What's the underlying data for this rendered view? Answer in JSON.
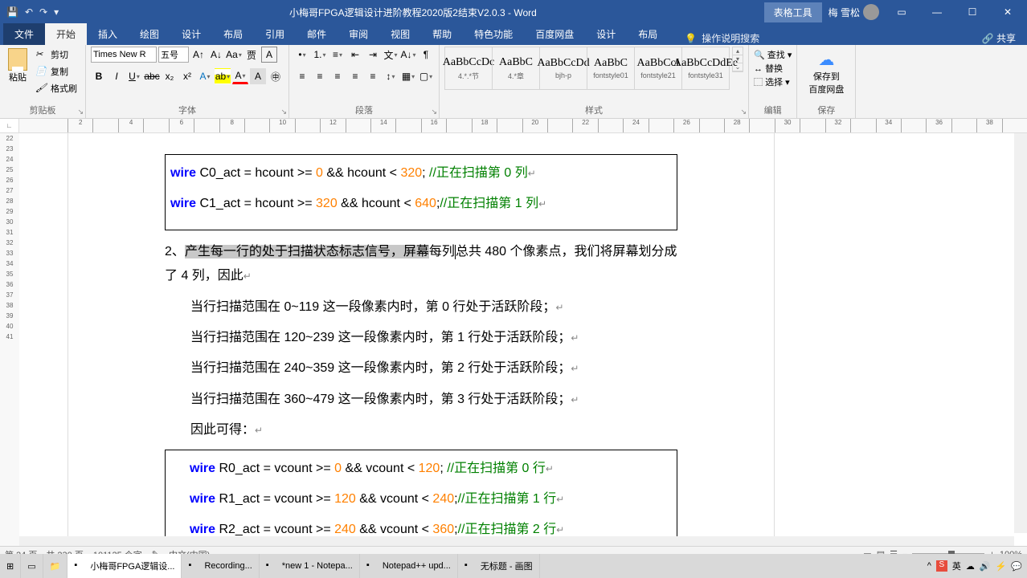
{
  "titlebar": {
    "doc_title": "小梅哥FPGA逻辑设计进阶教程2020版2结束V2.0.3  -  Word",
    "table_tools": "表格工具",
    "user_name": "梅 雪松"
  },
  "tabs": {
    "file": "文件",
    "home": "开始",
    "insert": "插入",
    "draw": "绘图",
    "design": "设计",
    "layout": "布局",
    "references": "引用",
    "mailings": "邮件",
    "review": "审阅",
    "view": "视图",
    "help": "帮助",
    "special": "特色功能",
    "baidu": "百度网盘",
    "t_design": "设计",
    "t_layout": "布局",
    "tellme": "操作说明搜索",
    "share": "共享"
  },
  "ribbon": {
    "clipboard": {
      "label": "剪贴板",
      "cut": "剪切",
      "copy": "复制",
      "fmt": "格式刷",
      "paste": "粘贴"
    },
    "font": {
      "label": "字体",
      "family": "Times New R",
      "size": "五号"
    },
    "para": {
      "label": "段落"
    },
    "styles": {
      "label": "样式",
      "items": [
        {
          "preview": "AaBbCcDc",
          "name": "4.*.*节"
        },
        {
          "preview": "AaBbC",
          "name": "4.*章"
        },
        {
          "preview": "AaBbCcDd",
          "name": "bjh-p"
        },
        {
          "preview": "AaBbC",
          "name": "fontstyle01"
        },
        {
          "preview": "AaBbCcI",
          "name": "fontstyle21"
        },
        {
          "preview": "AaBbCcDdEe",
          "name": "fontstyle31"
        }
      ]
    },
    "editing": {
      "label": "编辑",
      "find": "查找",
      "replace": "替换",
      "select": "选择"
    },
    "save": {
      "label": "保存",
      "btn": "保存到\n百度网盘"
    }
  },
  "ruler_h": [
    "2",
    "",
    "4",
    "",
    "6",
    "",
    "8",
    "",
    "10",
    "",
    "12",
    "",
    "14",
    "",
    "16",
    "",
    "18",
    "",
    "20",
    "",
    "22",
    "",
    "24",
    "",
    "26",
    "",
    "28",
    "",
    "30",
    "",
    "32",
    "",
    "34",
    "",
    "36",
    "",
    "38",
    ""
  ],
  "ruler_v": [
    "22",
    "23",
    "24",
    "25",
    "26",
    "27",
    "28",
    "29",
    "30",
    "31",
    "32",
    "33",
    "34",
    "35",
    "36",
    "37",
    "38",
    "39",
    "40",
    "41"
  ],
  "doc": {
    "c0_pre": "wire",
    "c0_a": " C0_act = hcount >= ",
    "c0_n1": "0",
    "c0_mid": " && hcount < ",
    "c0_n2": "320",
    "c0_end": "; ",
    "c0_cmt": "//正在扫描第 0 列",
    "c1_pre": "wire",
    "c1_a": " C1_act = hcount >= ",
    "c1_n1": "320",
    "c1_mid": " && hcount < ",
    "c1_n2": "640",
    "c1_end": ";",
    "c1_cmt": "//正在扫描第 1 列",
    "p2_num": "2、",
    "p2_sel": "产生每一行的处于扫描状态标志信号，屏幕",
    "p2_rest1": "每列",
    "p2_rest2": "总共 480 个像素点，我们将屏幕划分成了 4 列，因此",
    "p3": "当行扫描范围在 0~119 这一段像素内时，第 0 行处于活跃阶段；",
    "p4": "当行扫描范围在 120~239 这一段像素内时，第 1 行处于活跃阶段；",
    "p5": "当行扫描范围在 240~359 这一段像素内时，第 2 行处于活跃阶段；",
    "p6": "当行扫描范围在 360~479 这一段像素内时，第 3 行处于活跃阶段；",
    "p7": "因此可得：",
    "r0_pre": "wire",
    "r0_a": " R0_act = vcount >= ",
    "r0_n1": "0",
    "r0_mid": " && vcount < ",
    "r0_n2": "120",
    "r0_end": ";    ",
    "r0_cmt": "//正在扫描第 0 行",
    "r1_pre": "wire",
    "r1_a": " R1_act = vcount >= ",
    "r1_n1": "120",
    "r1_mid": " && vcount < ",
    "r1_n2": "240",
    "r1_end": ";",
    "r1_cmt": "//正在扫描第 1 行",
    "r2_pre": "wire",
    "r2_a": " R2_act = vcount >= ",
    "r2_n1": "240",
    "r2_mid": " && vcount < ",
    "r2_n2": "360",
    "r2_end": ";",
    "r2_cmt": "//正在扫描第 2 行"
  },
  "status": {
    "page": "第 24 页，共 230 页",
    "words": "101125 个字",
    "lang": "中文(中国)",
    "zoom": "100%"
  },
  "taskbar": {
    "items": [
      {
        "label": "小梅哥FPGA逻辑设..."
      },
      {
        "label": "Recording..."
      },
      {
        "label": "*new 1 - Notepa..."
      },
      {
        "label": "Notepad++ upd..."
      },
      {
        "label": "无标题 - 画图"
      }
    ],
    "tray_lang": "英",
    "time": ""
  }
}
